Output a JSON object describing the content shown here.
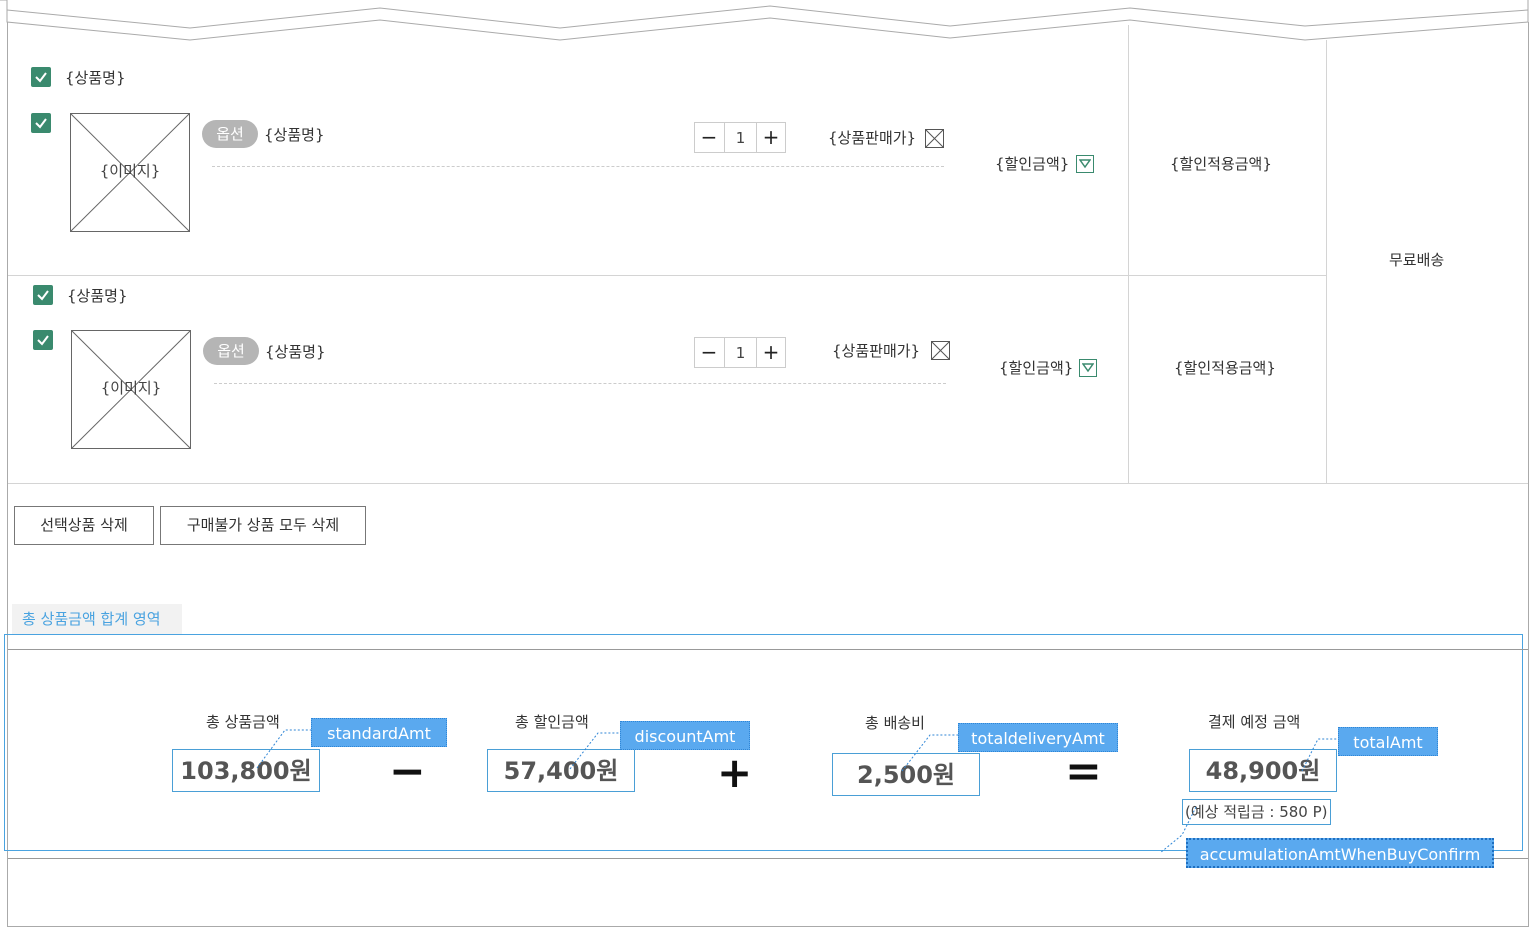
{
  "colors": {
    "accent_green": "#3a8a6e",
    "accent_blue": "#4aa3e0",
    "tag_blue": "#5aa9ef"
  },
  "rows": [
    {
      "group_title": "{상품명}",
      "image_placeholder": "{이미지}",
      "option_badge": "옵션",
      "product_name": "{상품명}",
      "quantity": "1",
      "minus": "−",
      "plus": "+",
      "sale_price": "{상품판매가}",
      "discount_amount": "{할인금액}",
      "discount_applied_amount": "{할인적용금액}"
    },
    {
      "group_title": "{상품명}",
      "image_placeholder": "{이미지}",
      "option_badge": "옵션",
      "product_name": "{상품명}",
      "quantity": "1",
      "minus": "−",
      "plus": "+",
      "sale_price": "{상품판매가}",
      "discount_amount": "{할인금액}",
      "discount_applied_amount": "{할인적용금액}"
    }
  ],
  "delivery": "무료배송",
  "actions": {
    "delete_selected": "선택상품 삭제",
    "delete_unavailable": "구매불가 상품 모두 삭제"
  },
  "summary": {
    "tab_label": "총 상품금액 합계 영역",
    "standard": {
      "label": "총 상품금액",
      "value": "103,800원",
      "tag": "standardAmt"
    },
    "discount": {
      "label": "총 할인금액",
      "value": "57,400원",
      "tag": "discountAmt"
    },
    "delivery": {
      "label": "총 배송비",
      "value": "2,500원",
      "tag": "totaldeliveryAmt"
    },
    "total": {
      "label": "결제 예정 금액",
      "value": "48,900원",
      "tag": "totalAmt"
    },
    "op_minus": "−",
    "op_plus": "+",
    "op_equals": "=",
    "accumulation": "(예상 적립금 :  580 P)",
    "accumulation_tag": "accumulationAmtWhenBuyConfirm"
  }
}
